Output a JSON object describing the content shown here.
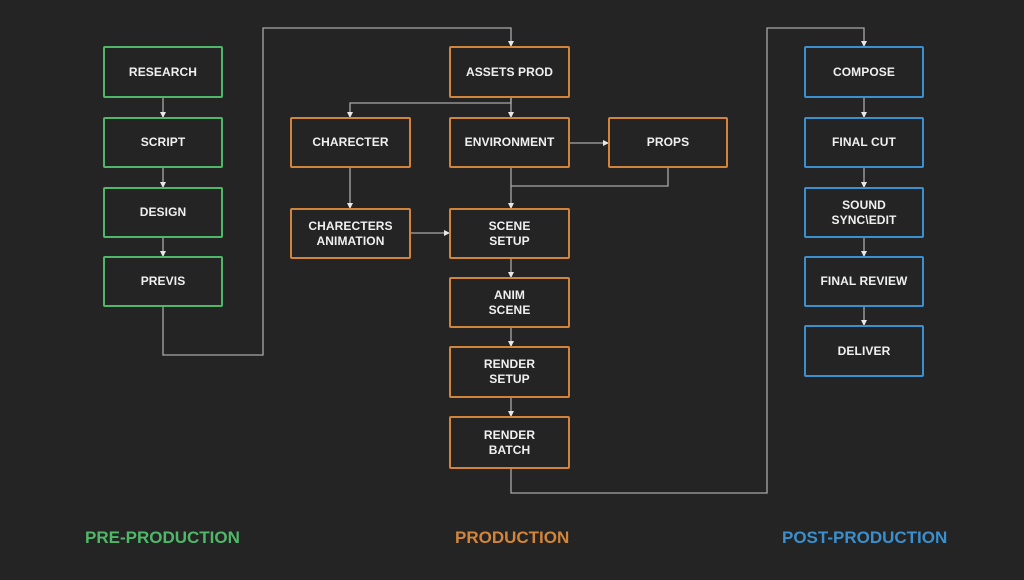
{
  "colors": {
    "background": "#242424",
    "pre_production": "#4fb868",
    "production": "#d2853a",
    "post_production": "#3a8fce",
    "connector": "#a8a8a8",
    "text": "#f0f0f0"
  },
  "phases": {
    "pre": {
      "label": "PRE-PRODUCTION"
    },
    "prod": {
      "label": "PRODUCTION"
    },
    "post": {
      "label": "POST-PRODUCTION"
    }
  },
  "nodes": {
    "research": {
      "label": "RESEARCH",
      "phase": "pre"
    },
    "script": {
      "label": "SCRIPT",
      "phase": "pre"
    },
    "design": {
      "label": "DESIGN",
      "phase": "pre"
    },
    "previs": {
      "label": "PREVIS",
      "phase": "pre"
    },
    "assets_prod": {
      "label": "ASSETS PROD",
      "phase": "prod"
    },
    "charecter": {
      "label": "CHARECTER",
      "phase": "prod"
    },
    "environment": {
      "label": "ENVIRONMENT",
      "phase": "prod"
    },
    "props": {
      "label": "PROPS",
      "phase": "prod"
    },
    "charecters_animation": {
      "label": "CHARECTERS\nANIMATION",
      "phase": "prod"
    },
    "scene_setup": {
      "label": "SCENE\nSETUP",
      "phase": "prod"
    },
    "anim_scene": {
      "label": "ANIM\nSCENE",
      "phase": "prod"
    },
    "render_setup": {
      "label": "RENDER\nSETUP",
      "phase": "prod"
    },
    "render_batch": {
      "label": "RENDER\nBATCH",
      "phase": "prod"
    },
    "compose": {
      "label": "COMPOSE",
      "phase": "post"
    },
    "final_cut": {
      "label": "FINAL CUT",
      "phase": "post"
    },
    "sound_sync_edit": {
      "label": "SOUND\nSYNC\\EDIT",
      "phase": "post"
    },
    "final_review": {
      "label": "FINAL REVIEW",
      "phase": "post"
    },
    "deliver": {
      "label": "DELIVER",
      "phase": "post"
    }
  },
  "edges": [
    {
      "from": "research",
      "to": "script"
    },
    {
      "from": "script",
      "to": "design"
    },
    {
      "from": "design",
      "to": "previs"
    },
    {
      "from": "previs",
      "to": "assets_prod"
    },
    {
      "from": "assets_prod",
      "to": "charecter"
    },
    {
      "from": "assets_prod",
      "to": "environment"
    },
    {
      "from": "environment",
      "to": "props"
    },
    {
      "from": "charecter",
      "to": "charecters_animation"
    },
    {
      "from": "charecters_animation",
      "to": "scene_setup"
    },
    {
      "from": "environment",
      "to": "scene_setup"
    },
    {
      "from": "props",
      "to": "scene_setup"
    },
    {
      "from": "scene_setup",
      "to": "anim_scene"
    },
    {
      "from": "anim_scene",
      "to": "render_setup"
    },
    {
      "from": "render_setup",
      "to": "render_batch"
    },
    {
      "from": "render_batch",
      "to": "compose"
    },
    {
      "from": "compose",
      "to": "final_cut"
    },
    {
      "from": "final_cut",
      "to": "sound_sync_edit"
    },
    {
      "from": "sound_sync_edit",
      "to": "final_review"
    },
    {
      "from": "final_review",
      "to": "deliver"
    }
  ]
}
